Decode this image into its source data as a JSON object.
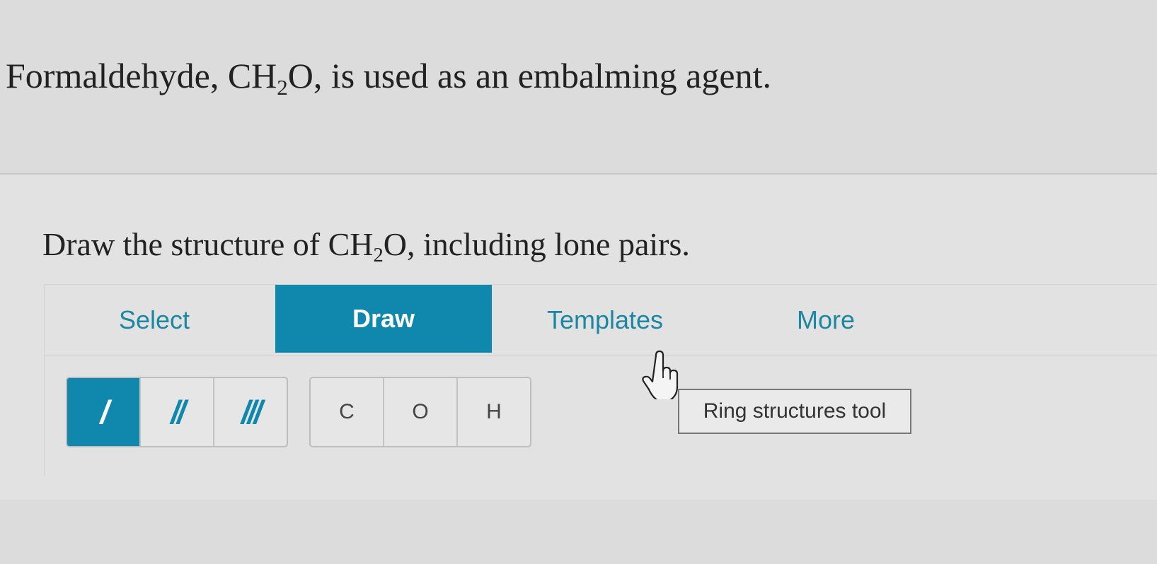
{
  "intro": {
    "pre": "Formaldehyde, CH",
    "sub": "2",
    "post": "O, is used as an embalming agent."
  },
  "question": {
    "pre": "Draw the structure of CH",
    "sub": "2",
    "post": "O, including lone pairs."
  },
  "tabs": [
    {
      "label": "Select",
      "active": false
    },
    {
      "label": "Draw",
      "active": true
    },
    {
      "label": "Templates",
      "active": false
    },
    {
      "label": "More",
      "active": false
    }
  ],
  "bond_tools": [
    {
      "glyph": "/",
      "active": true
    },
    {
      "glyph": "//",
      "active": false
    },
    {
      "glyph": "///",
      "active": false
    }
  ],
  "atom_tools": [
    {
      "label": "C"
    },
    {
      "label": "O"
    },
    {
      "label": "H"
    }
  ],
  "tooltip": "Ring structures tool",
  "colors": {
    "accent": "#1088ad",
    "tab_text": "#1b87a3"
  },
  "icons": {
    "cursor": "hand-pointer-icon"
  }
}
